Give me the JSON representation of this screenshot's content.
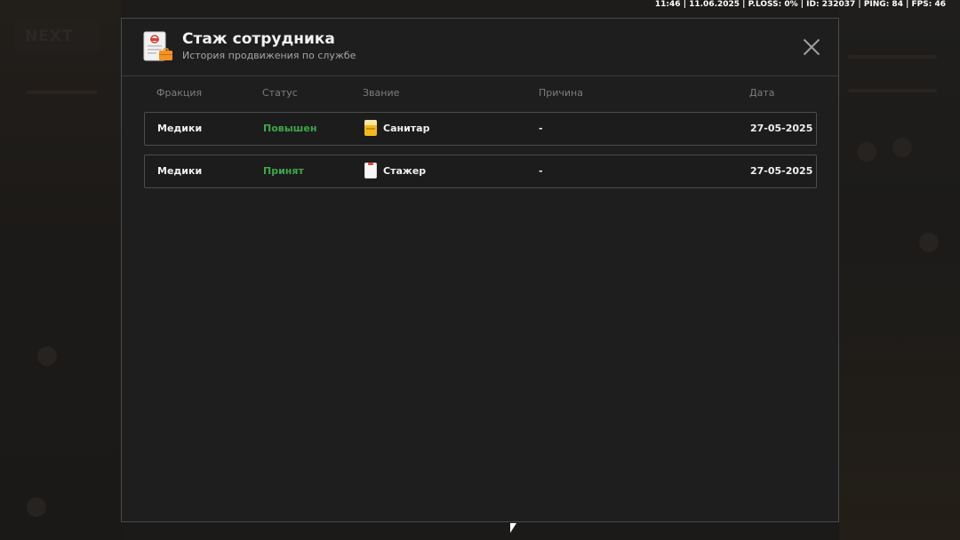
{
  "status_bar": "11:46 | 11.06.2025 | P.LOSS: 0% | ID: 232037 | PING: 84 | FPS: 46",
  "modal": {
    "title": "Стаж сотрудника",
    "subtitle": "История продвижения по службе",
    "icon": "document-briefcase-icon"
  },
  "table": {
    "headers": [
      "Фракция",
      "Статус",
      "Звание",
      "Причина",
      "Дата"
    ],
    "rows": [
      {
        "faction": "Медики",
        "status": "Повышен",
        "rank": "Санитар",
        "rank_icon": "sanitar-badge-icon",
        "reason": "-",
        "date": "27-05-2025"
      },
      {
        "faction": "Медики",
        "status": "Принят",
        "rank": "Стажер",
        "rank_icon": "intern-badge-icon",
        "reason": "-",
        "date": "27-05-2025"
      }
    ]
  },
  "colors": {
    "status_positive": "#3ea64a",
    "modal_bg": "#1e1e1e",
    "border": "#4c4c4c"
  }
}
